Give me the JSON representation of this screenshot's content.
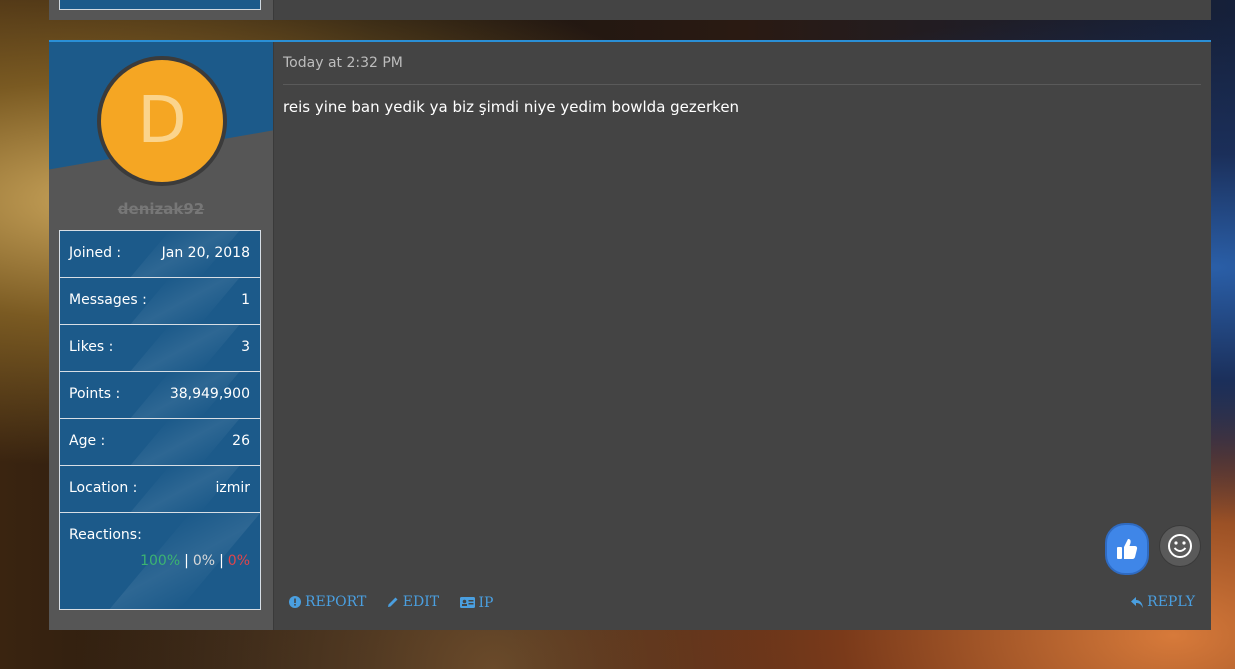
{
  "post": {
    "username": "denizak92",
    "avatar_letter": "D",
    "avatar_color": "#f5a623",
    "stats": [
      {
        "label": "Joined :",
        "value": "Jan 20, 2018"
      },
      {
        "label": "Messages :",
        "value": "1"
      },
      {
        "label": "Likes :",
        "value": "3"
      },
      {
        "label": "Points :",
        "value": "38,949,900"
      },
      {
        "label": "Age :",
        "value": "26"
      },
      {
        "label": "Location :",
        "value": "izmir"
      }
    ],
    "reactions": {
      "label": "Reactions:",
      "positive": "100%",
      "neutral": "0%",
      "negative": "0%",
      "separator": "|"
    },
    "timestamp": "Today at 2:32 PM",
    "message": "reis yine ban yedik ya biz şimdi niye yedim bowlda gezerken",
    "actions": {
      "report": "REPORT",
      "edit": "EDIT",
      "ip": "IP",
      "reply": "REPLY"
    },
    "icons": {
      "like": "thumbs-up-icon",
      "reaction_picker": "smiley-icon",
      "report": "info-circle-icon",
      "edit": "pencil-icon",
      "ip": "id-card-icon",
      "reply": "reply-arrow-icon"
    },
    "accent_color": "#2a8fd6",
    "link_color": "#4a9fe0"
  }
}
